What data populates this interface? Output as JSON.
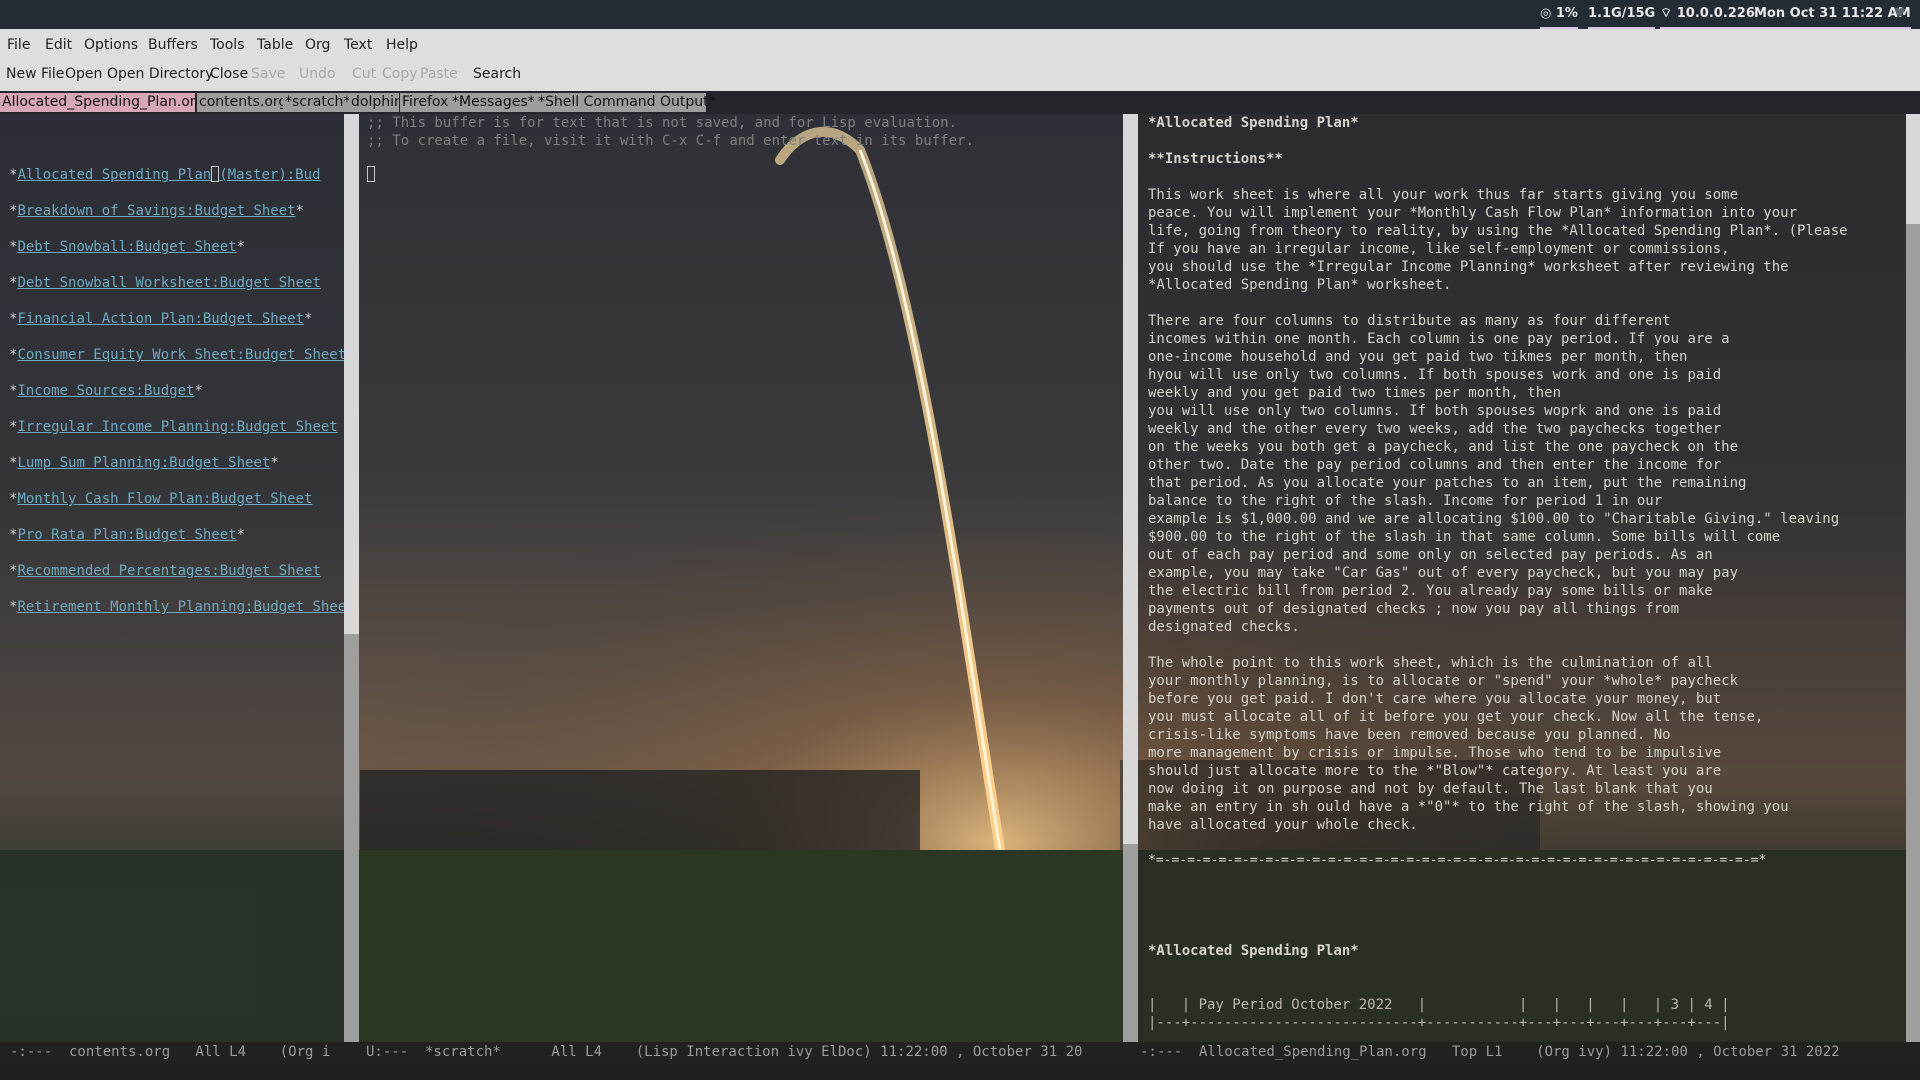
{
  "system_bar": {
    "cpu": "1%",
    "memory": "1.1G/15G",
    "ip": "10.0.0.226",
    "datetime": "Mon Oct 31 11:22 AM"
  },
  "menubar": [
    "File",
    "Edit",
    "Options",
    "Buffers",
    "Tools",
    "Table",
    "Org",
    "Text",
    "Help"
  ],
  "toolbar": {
    "new_file": "New File",
    "open": "Open",
    "open_directory": "Open Directory",
    "close": "Close",
    "save": "Save",
    "undo": "Undo",
    "cut": "Cut",
    "copy": "Copy",
    "paste": "Paste",
    "search": "Search"
  },
  "tabs": [
    "Allocated_Spending_Plan.org",
    "contents.org",
    "*scratch*",
    "dolphin",
    "Firefox",
    "*Messages*",
    "*Shell Command Output*"
  ],
  "left_pane": {
    "links": [
      "Allocated Spending Plan",
      "Breakdown of Savings:Budget Sheet",
      "Debt Snowball:Budget Sheet",
      "Debt Snowball Worksheet:Budget Sheet",
      "Financial Action Plan:Budget Sheet",
      "Consumer Equity Work Sheet:Budget Sheet",
      "Income Sources:Budget",
      "Irregular Income Planning:Budget Sheet",
      "Lump Sum Planning:Budget Sheet",
      "Monthly Cash Flow Plan:Budget Sheet",
      "Pro Rata Plan:Budget Sheet",
      "Recommended Percentages:Budget Sheet",
      "Retirement Monthly Planning:Budget Sheet"
    ],
    "first_suffix": "(Master):Bud"
  },
  "scratch": {
    "line1": ";; This buffer is for text that is not saved, and for Lisp evaluation.",
    "line2": ";; To create a file, visit it with C-x C-f and enter text in its buffer."
  },
  "right_pane": {
    "title": "*Allocated Spending Plan*",
    "instructions": "**Instructions**",
    "paragraphs": [
      [
        "This work sheet is where all your work thus far starts giving you some",
        "peace. You will implement your *Monthly Cash Flow Plan* information into your",
        "life, going from theory to reality, by using the *Allocated Spending Plan*. (Please",
        "If you have an irregular income, like self-employment or commissions,",
        "you should use the *Irregular Income Planning* worksheet after reviewing the",
        "*Allocated Spending Plan* worksheet."
      ],
      [
        "There are four columns to distribute as many as four different",
        "incomes within one month. Each column is one pay period. If you are a",
        "one-income household and you get paid two tikmes per month, then",
        "hyou will use only two columns. If both spouses work and one is paid",
        "weekly and you get paid two times per month, then",
        "you will use only two columns. If both spouses woprk and one is paid",
        "weekly and the other every two weeks, add the two paychecks together",
        "on the weeks you both get a paycheck, and list the one paycheck on the",
        "other two. Date the pay period columns and then enter the income for",
        "that period. As you allocate your patches to an item, put the remaining",
        "balance to the right of the slash. Income for period 1 in our",
        "example is $1,000.00 and we are allocating $100.00 to \"Charitable Giving.\" leaving",
        "$900.00 to the right of the slash in that same column. Some bills will come",
        "out of each pay period and some only on selected pay periods. As an",
        "example, you may take \"Car Gas\" out of every paycheck, but you may pay",
        "the electric bill from period 2. You already pay some bills or make",
        "payments out of designated checks ; now you pay all things from",
        "designated checks."
      ],
      [
        "The whole point to this work sheet, which is the culmination of all",
        "your monthly planning, is to allocate or \"spend\" your *whole* paycheck",
        "before you get paid. I don't care where you allocate your money, but",
        "you must allocate all of it before you get your check. Now all the tense,",
        "crisis-like symptoms have been removed because you planned. No",
        "more management by crisis or impulse. Those who tend to be impulsive",
        "should just allocate more to the *\"Blow\"* category. At least you are",
        "now doing it on purpose and not by default. The last blank that you",
        "make an entry in sh ould have a *\"0\"* to the right of the slash, showing you",
        "have allocated your whole check."
      ]
    ],
    "rule": "*=-=-=-=-=-=-=-=-=-=-=-=-=-=-=-=-=-=-=-=-=-=-=-=-=-=-=-=-=-=-=-=-=-=-=-=-=-=-=*",
    "section_heading": "*Allocated Spending Plan*",
    "table_header": "|   | Pay Period October 2022   |           |   |   |   |   | 3 | 4 |",
    "table_rule": "|---+---------------------------+-----------+---+---+---+---+---+---|"
  },
  "modeline": {
    "left": "-:---  contents.org   All L4    (Org i",
    "mid": "U:---  *scratch*      All L4    (Lisp Interaction ivy ElDoc) 11:22:00 , October 31 20",
    "right": "-:---  Allocated_Spending_Plan.org   Top L1    (Org ivy) 11:22:00 , October 31 2022"
  }
}
